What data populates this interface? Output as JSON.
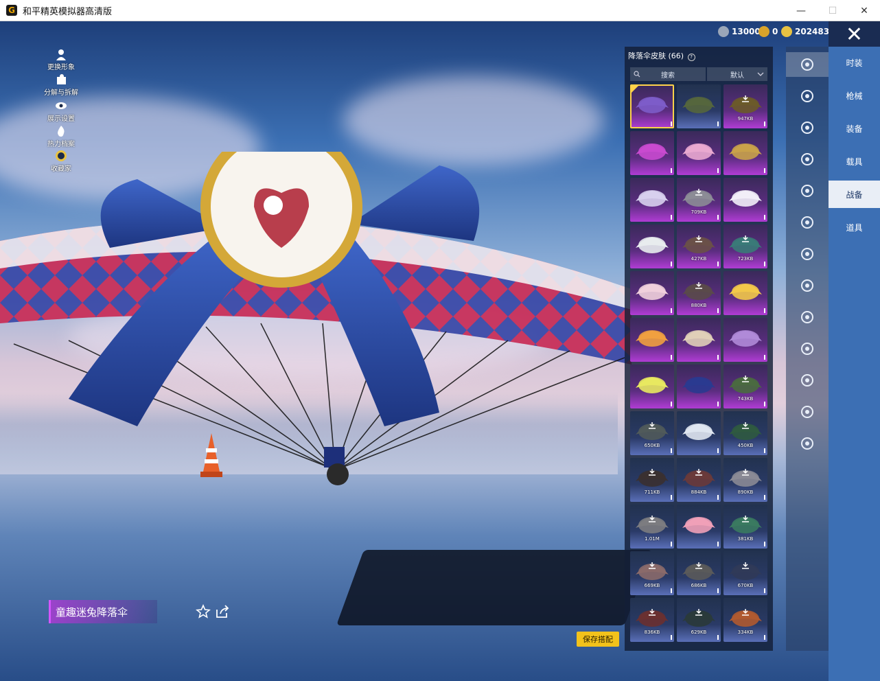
{
  "window": {
    "title": "和平精英模拟器高清版",
    "icon_glyph": "G",
    "controls": [
      "—",
      "☐",
      "✕"
    ]
  },
  "currency": [
    {
      "value": "13000",
      "color": "#9aa6b8"
    },
    {
      "value": "0",
      "color": "#d9a32a"
    },
    {
      "value": "202483",
      "color": "#e8c242"
    }
  ],
  "close_icon": "✕",
  "left_tools": [
    {
      "label": "更换形象",
      "icon": "person-icon"
    },
    {
      "label": "分解与拆解",
      "icon": "puzzle-icon"
    },
    {
      "label": "展示设置",
      "icon": "eye-icon"
    },
    {
      "label": "热力档案",
      "icon": "flame-icon"
    },
    {
      "label": "收藏家",
      "icon": "badge-icon"
    }
  ],
  "skin_name": "童趣迷兔降落伞",
  "save_label": "保存搭配",
  "panel": {
    "title": "降落伞皮肤 (66)",
    "help_glyph": "?",
    "search_placeholder": "搜索",
    "sort_label": "默认"
  },
  "skins": [
    {
      "size": "",
      "style": "purple",
      "selected": true,
      "color": "#7d5cc9",
      "download": false
    },
    {
      "size": "",
      "style": "blue",
      "selected": false,
      "color": "#55663d",
      "download": false
    },
    {
      "size": "947KB",
      "style": "purple",
      "selected": false,
      "color": "#6b5a2a",
      "download": true
    },
    {
      "size": "",
      "style": "purple",
      "selected": false,
      "color": "#c94ad0",
      "download": false
    },
    {
      "size": "",
      "style": "purple",
      "selected": false,
      "color": "#e9a9d0",
      "download": false
    },
    {
      "size": "",
      "style": "purple",
      "selected": false,
      "color": "#c9a24a",
      "download": false
    },
    {
      "size": "",
      "style": "purple",
      "selected": false,
      "color": "#d8d0ee",
      "download": false
    },
    {
      "size": "709KB",
      "style": "purple",
      "selected": false,
      "color": "#8c8c96",
      "download": true
    },
    {
      "size": "",
      "style": "purple",
      "selected": false,
      "color": "#f2eef8",
      "download": false
    },
    {
      "size": "",
      "style": "purple",
      "selected": false,
      "color": "#e8ecee",
      "download": false
    },
    {
      "size": "427KB",
      "style": "purple",
      "selected": false,
      "color": "#6a5048",
      "download": true
    },
    {
      "size": "723KB",
      "style": "purple",
      "selected": false,
      "color": "#3a7a78",
      "download": true
    },
    {
      "size": "",
      "style": "purple",
      "selected": false,
      "color": "#f0d0dc",
      "download": false
    },
    {
      "size": "880KB",
      "style": "purple",
      "selected": false,
      "color": "#5a4a4a",
      "download": true
    },
    {
      "size": "",
      "style": "purple",
      "selected": false,
      "color": "#f2c84a",
      "download": false
    },
    {
      "size": "",
      "style": "purple",
      "selected": false,
      "color": "#f0a040",
      "download": false
    },
    {
      "size": "",
      "style": "purple",
      "selected": false,
      "color": "#e0cfb8",
      "download": false
    },
    {
      "size": "",
      "style": "purple",
      "selected": false,
      "color": "#b08ad8",
      "download": false
    },
    {
      "size": "",
      "style": "purple",
      "selected": false,
      "color": "#e8e860",
      "download": false
    },
    {
      "size": "",
      "style": "purple",
      "selected": false,
      "color": "#2a3a90",
      "download": false
    },
    {
      "size": "743KB",
      "style": "purple",
      "selected": false,
      "color": "#4a6a40",
      "download": true
    },
    {
      "size": "650KB",
      "style": "blue",
      "selected": false,
      "color": "#505a5a",
      "download": true
    },
    {
      "size": "",
      "style": "blue",
      "selected": false,
      "color": "#dfe6f0",
      "download": false
    },
    {
      "size": "450KB",
      "style": "blue",
      "selected": false,
      "color": "#2f5a40",
      "download": true
    },
    {
      "size": "711KB",
      "style": "blue",
      "selected": false,
      "color": "#3a3030",
      "download": true
    },
    {
      "size": "884KB",
      "style": "blue",
      "selected": false,
      "color": "#6a3a3a",
      "download": true
    },
    {
      "size": "890KB",
      "style": "blue",
      "selected": false,
      "color": "#8a8a95",
      "download": true
    },
    {
      "size": "1.01M",
      "style": "blue",
      "selected": false,
      "color": "#7c7c80",
      "download": true
    },
    {
      "size": "",
      "style": "blue",
      "selected": false,
      "color": "#f0a0b8",
      "download": false
    },
    {
      "size": "381KB",
      "style": "blue",
      "selected": false,
      "color": "#3a7a60",
      "download": true
    },
    {
      "size": "669KB",
      "style": "blue",
      "selected": false,
      "color": "#8a6a6a",
      "download": true
    },
    {
      "size": "686KB",
      "style": "blue",
      "selected": false,
      "color": "#5a5a5a",
      "download": true
    },
    {
      "size": "670KB",
      "style": "blue",
      "selected": false,
      "color": "#303a58",
      "download": true
    },
    {
      "size": "836KB",
      "style": "blue",
      "selected": false,
      "color": "#6a3030",
      "download": true
    },
    {
      "size": "629KB",
      "style": "blue",
      "selected": false,
      "color": "#2a3a3a",
      "download": true
    },
    {
      "size": "334KB",
      "style": "blue",
      "selected": false,
      "color": "#b05a30",
      "download": true
    }
  ],
  "side_icons": [
    {
      "name": "parachute-tab-icon",
      "active": true
    },
    {
      "name": "helmet-icon",
      "active": false
    },
    {
      "name": "drone-icon",
      "active": false
    },
    {
      "name": "plane-icon",
      "active": false
    },
    {
      "name": "face-icon",
      "active": false
    },
    {
      "name": "robot-icon",
      "active": false
    },
    {
      "name": "speaker-icon",
      "active": false
    },
    {
      "name": "box-icon",
      "active": false
    },
    {
      "name": "image-icon",
      "active": false
    },
    {
      "name": "bottle-icon",
      "active": false
    },
    {
      "name": "glove-icon",
      "active": false
    },
    {
      "name": "sparkle-icon",
      "active": false
    },
    {
      "name": "ufo-icon",
      "active": false
    }
  ],
  "categories": [
    {
      "label": "时装",
      "active": false
    },
    {
      "label": "枪械",
      "active": false
    },
    {
      "label": "装备",
      "active": false
    },
    {
      "label": "载具",
      "active": false
    },
    {
      "label": "战备",
      "active": true
    },
    {
      "label": "道具",
      "active": false
    }
  ]
}
